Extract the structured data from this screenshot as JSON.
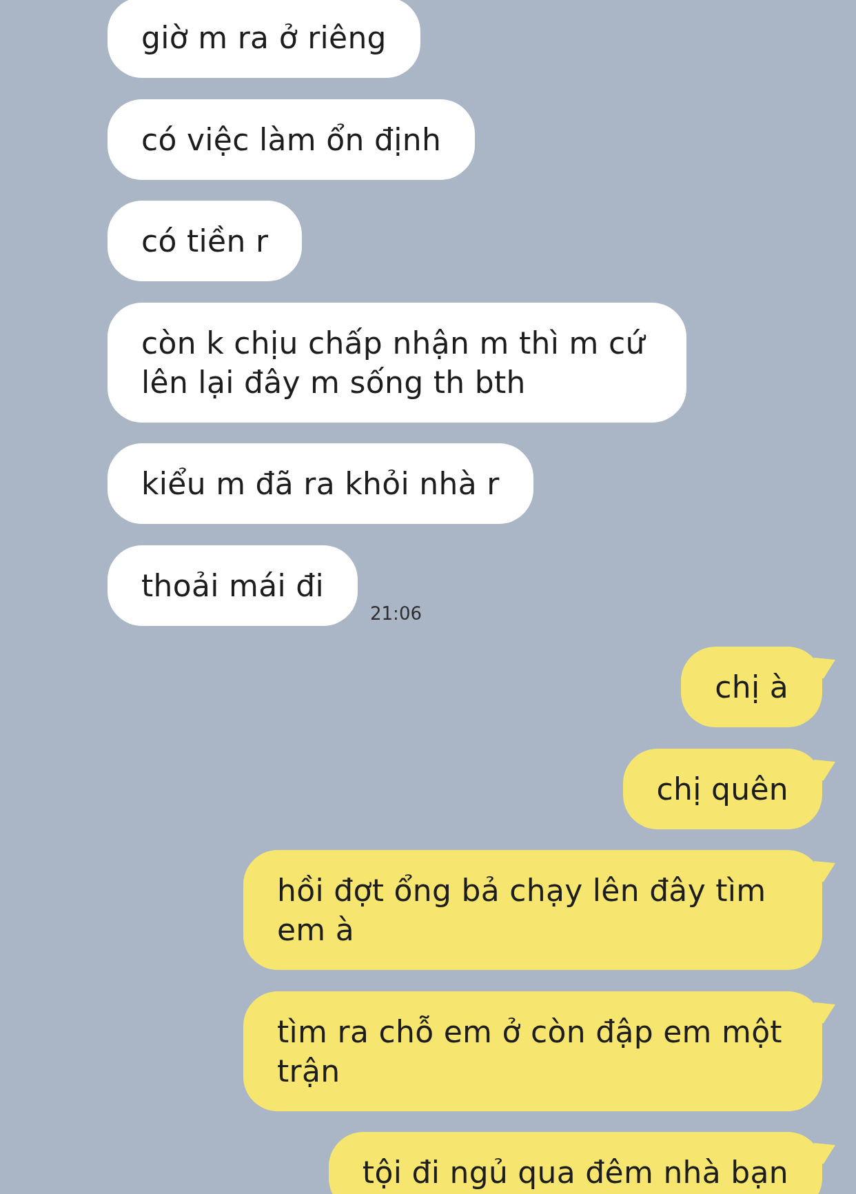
{
  "messages": [
    {
      "kind": "received",
      "lines": [
        "giờ m ra ở riêng"
      ]
    },
    {
      "kind": "received",
      "lines": [
        "có việc làm ổn định"
      ]
    },
    {
      "kind": "received",
      "lines": [
        "có tiền r"
      ]
    },
    {
      "kind": "received",
      "lines": [
        "còn k chịu chấp nhận m thì m cứ",
        "lên lại đây m sống th bth"
      ]
    },
    {
      "kind": "received",
      "lines": [
        "kiểu m đã ra khỏi nhà r"
      ]
    },
    {
      "kind": "received",
      "lines": [
        "thoải mái đi"
      ],
      "time": "21:06"
    },
    {
      "kind": "sent",
      "lines": [
        "chị à"
      ]
    },
    {
      "kind": "sent",
      "lines": [
        "chị quên"
      ]
    },
    {
      "kind": "sent",
      "lines": [
        "hồi đợt ổng bả chạy lên đây tìm",
        "em à"
      ]
    },
    {
      "kind": "sent",
      "lines": [
        "tìm ra chỗ em ở còn đập em một",
        "trận"
      ]
    },
    {
      "kind": "sent",
      "lines": [
        "tội đi ngủ qua đêm nhà bạn"
      ]
    }
  ]
}
